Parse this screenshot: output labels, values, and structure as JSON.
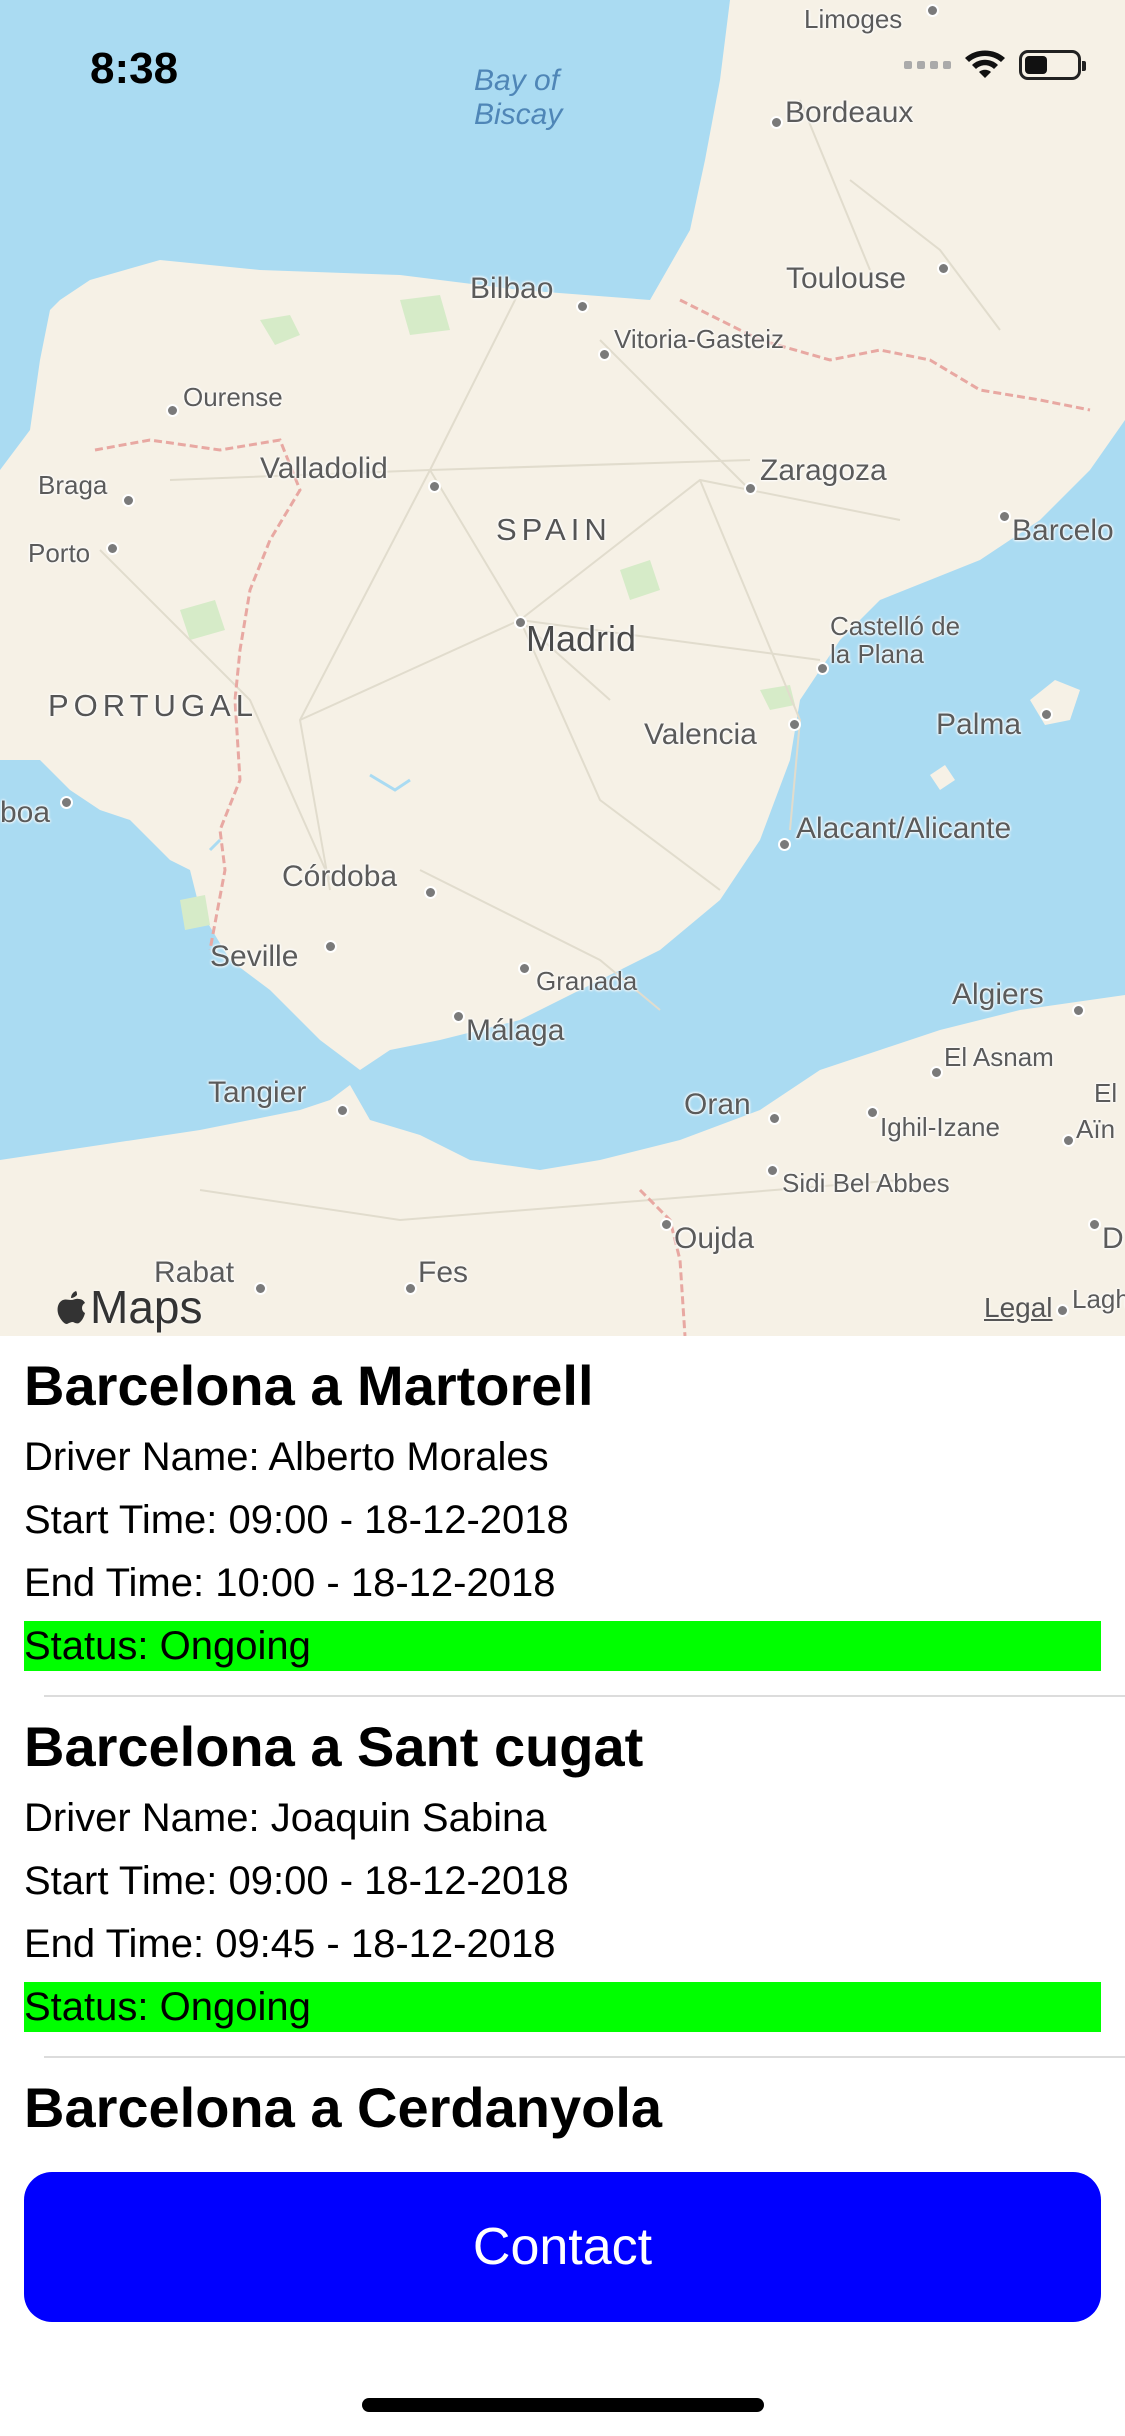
{
  "status_bar": {
    "time": "8:38"
  },
  "map": {
    "water_labels": [
      "Bay of",
      "Biscay"
    ],
    "countries": [
      "SPAIN",
      "PORTUGAL"
    ],
    "places": {
      "limoges": "Limoges",
      "bordeaux": "Bordeaux",
      "bilbao": "Bilbao",
      "toulouse": "Toulouse",
      "vitoria": "Vitoria-Gasteiz",
      "ourense": "Ourense",
      "valladolid": "Valladolid",
      "zaragoza": "Zaragoza",
      "braga": "Braga",
      "barcelona": "Barcelo",
      "porto": "Porto",
      "madrid": "Madrid",
      "castello_1": "Castelló de",
      "castello_2": "la Plana",
      "valencia": "Valencia",
      "palma": "Palma",
      "lisboa": "boa",
      "alicante": "Alacant/Alicante",
      "cordoba": "Córdoba",
      "seville": "Seville",
      "granada": "Granada",
      "malaga": "Málaga",
      "algiers": "Algiers",
      "el_asnam": "El Asnam",
      "el": "El",
      "tangier": "Tangier",
      "oran": "Oran",
      "ighil": "Ighil-Izane",
      "ain": "Aïn",
      "sidi": "Sidi Bel Abbes",
      "oujda": "Oujda",
      "d": "D",
      "rabat": "Rabat",
      "fes": "Fes",
      "lagh": "Lagh"
    },
    "logo_text": "Maps",
    "legal": "Legal"
  },
  "trips": [
    {
      "title": "Barcelona a Martorell",
      "driver": "Driver Name: Alberto Morales",
      "start": "Start Time: 09:00 - 18-12-2018",
      "end": "End Time: 10:00 - 18-12-2018",
      "status": "Status: Ongoing",
      "status_color": "#00ff00"
    },
    {
      "title": "Barcelona a Sant cugat",
      "driver": "Driver Name: Joaquin Sabina",
      "start": "Start Time: 09:00 - 18-12-2018",
      "end": "End Time: 09:45 - 18-12-2018",
      "status": "Status: Ongoing",
      "status_color": "#00ff00"
    },
    {
      "title": "Barcelona a Cerdanyola"
    }
  ],
  "contact_button": {
    "label": "Contact",
    "color": "#0000ff"
  }
}
